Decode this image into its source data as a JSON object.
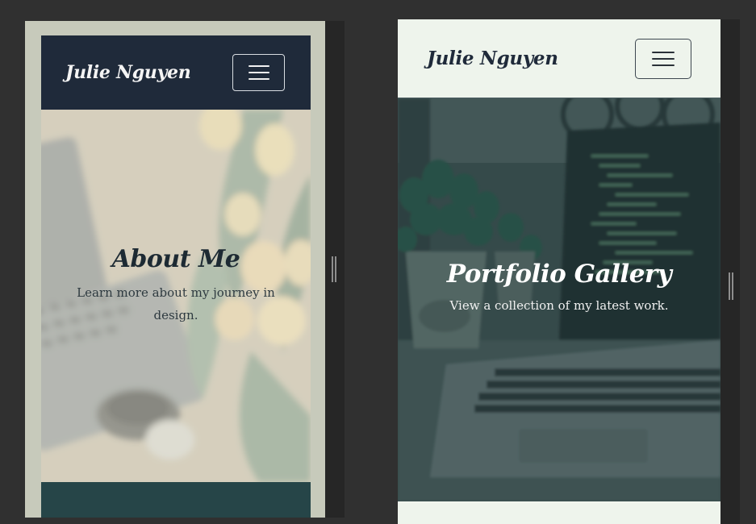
{
  "left_preview": {
    "brand": "Julie Nguyen",
    "hero_title": "About Me",
    "hero_subtitle": "Learn more about my journey in design."
  },
  "right_preview": {
    "brand": "Julie Nguyen",
    "hero_title": "Portfolio Gallery",
    "hero_subtitle": "View a collection of my latest work."
  },
  "icons": {
    "menu": "hamburger-menu-icon",
    "resize": "resize-grip-icon"
  },
  "colors": {
    "dark_navbar": "#1f2a3a",
    "light_navbar": "#eef4ec",
    "teal_footer": "#264548",
    "frame_background": "#303030"
  }
}
